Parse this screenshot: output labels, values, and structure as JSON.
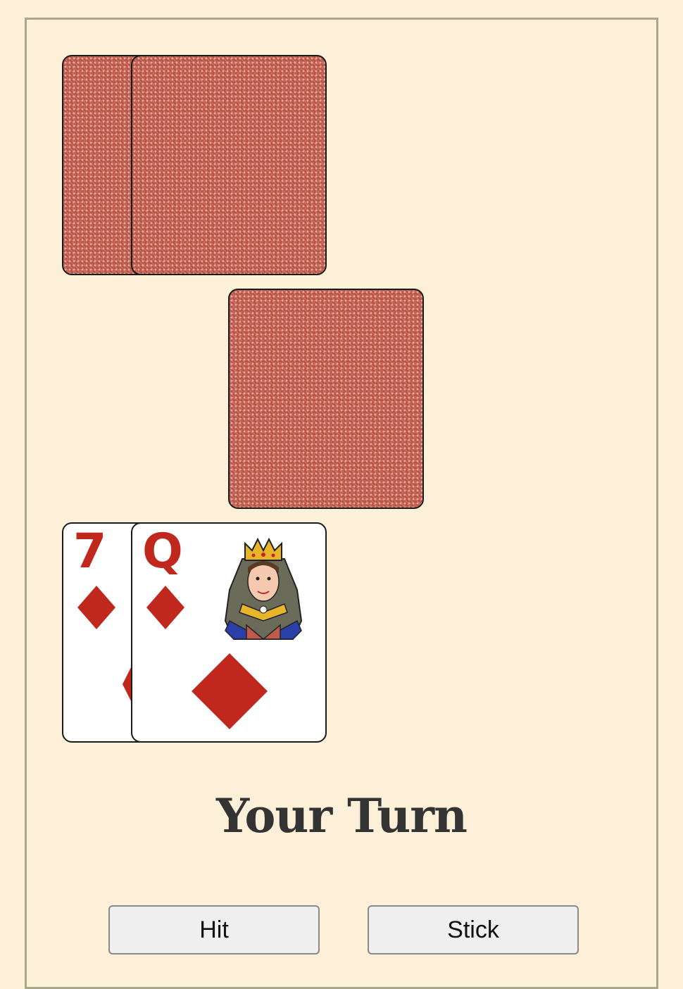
{
  "game": {
    "status_text": "Your Turn"
  },
  "dealer_hand": {
    "cards": [
      {
        "face": "down"
      },
      {
        "face": "down"
      }
    ]
  },
  "deck": {
    "face": "down"
  },
  "player_hand": {
    "cards": [
      {
        "rank": "7",
        "suit": "diamonds",
        "suit_color": "#c0281e"
      },
      {
        "rank": "Q",
        "suit": "diamonds",
        "suit_color": "#c0281e"
      }
    ]
  },
  "controls": {
    "hit_label": "Hit",
    "stick_label": "Stick"
  },
  "colors": {
    "background": "#fcf0d8",
    "card_back": "#c25a4c",
    "red_suit": "#c0281e",
    "border": "#a9a98a"
  }
}
